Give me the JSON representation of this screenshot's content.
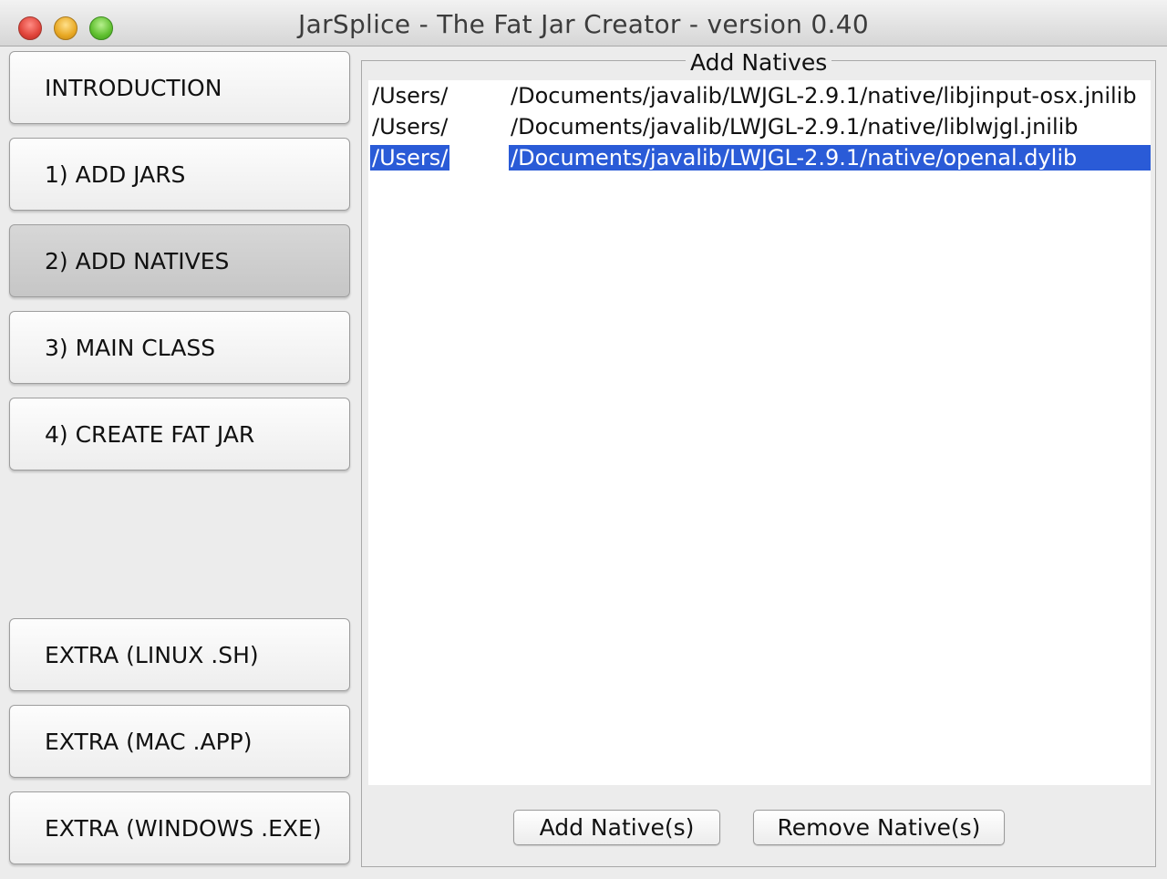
{
  "window": {
    "title": "JarSplice - The Fat Jar Creator - version 0.40"
  },
  "nav": {
    "items": [
      {
        "label": "INTRODUCTION"
      },
      {
        "label": "1) ADD JARS"
      },
      {
        "label": "2) ADD NATIVES",
        "selected": true
      },
      {
        "label": "3) MAIN CLASS"
      },
      {
        "label": "4) CREATE FAT JAR"
      }
    ],
    "extras": [
      {
        "label": "EXTRA (LINUX .SH)"
      },
      {
        "label": "EXTRA (MAC .APP)"
      },
      {
        "label": "EXTRA (WINDOWS .EXE)"
      }
    ]
  },
  "panel": {
    "title": "Add Natives",
    "files": [
      {
        "prefix": "/Users/",
        "path": "/Documents/javalib/LWJGL-2.9.1/native/libjinput-osx.jnilib",
        "selected": false
      },
      {
        "prefix": "/Users/",
        "path": "/Documents/javalib/LWJGL-2.9.1/native/liblwjgl.jnilib",
        "selected": false
      },
      {
        "prefix": "/Users/",
        "path": "/Documents/javalib/LWJGL-2.9.1/native/openal.dylib",
        "selected": true
      }
    ],
    "add_button": "Add Native(s)",
    "remove_button": "Remove Native(s)"
  },
  "colors": {
    "selection": "#2a5bd7"
  }
}
